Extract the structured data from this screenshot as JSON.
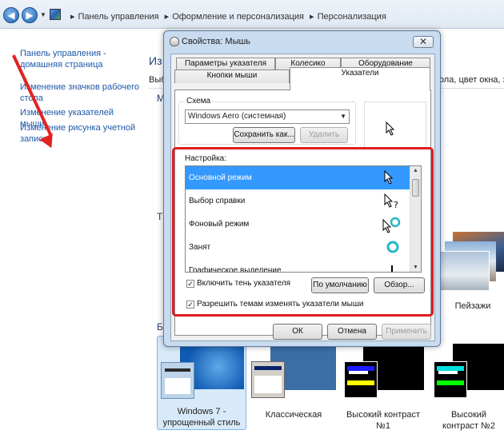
{
  "breadcrumb": [
    "Панель управления",
    "Оформление и персонализация",
    "Персонализация"
  ],
  "sidebar": {
    "links": [
      "Панель управления - домашняя страница",
      "Изменение значков рабочего стола",
      "Изменение указателей мыши",
      "Изменение рисунка учетной записи"
    ]
  },
  "main": {
    "heading": "Из",
    "subtext_left": "Выб",
    "subtext_right": "тола, цвет окна, зв",
    "label_my": "М",
    "label_t": "Т",
    "label_b": "Б"
  },
  "themes": [
    {
      "label": "Пейзажи"
    },
    {
      "label": "Windows 7 - упрощенный стиль"
    },
    {
      "label": "Классическая"
    },
    {
      "label": "Высокий контраст №1"
    },
    {
      "label": "Высокий контраст №2"
    }
  ],
  "dialog": {
    "title": "Свойства: Мышь",
    "close": "✕",
    "tabs_back": [
      "Параметры указателя",
      "Колесико",
      "Оборудование"
    ],
    "tabs_front": [
      "Кнопки мыши",
      "Указатели"
    ],
    "active_tab": "Указатели",
    "scheme_label": "Схема",
    "scheme_value": "Windows Aero (системная)",
    "save_as": "Сохранить как...",
    "delete": "Удалить",
    "customize_label": "Настройка:",
    "cursors": [
      {
        "name": "Основной режим",
        "icon": "arrow-cursor-icon"
      },
      {
        "name": "Выбор справки",
        "icon": "help-cursor-icon"
      },
      {
        "name": "Фоновый режим",
        "icon": "busy-background-cursor-icon"
      },
      {
        "name": "Занят",
        "icon": "busy-cursor-icon"
      },
      {
        "name": "Графическое выделение",
        "icon": "crosshair-cursor-icon"
      }
    ],
    "shadow_checkbox": "Включить тень указателя",
    "default_btn": "По умолчанию",
    "browse_btn": "Обзор...",
    "themes_checkbox": "Разрешить темам изменять указатели мыши",
    "ok": "ОК",
    "cancel": "Отмена",
    "apply": "Применить"
  },
  "colors": {
    "highlight": "#3399ff",
    "annotation": "#e01d1d"
  }
}
